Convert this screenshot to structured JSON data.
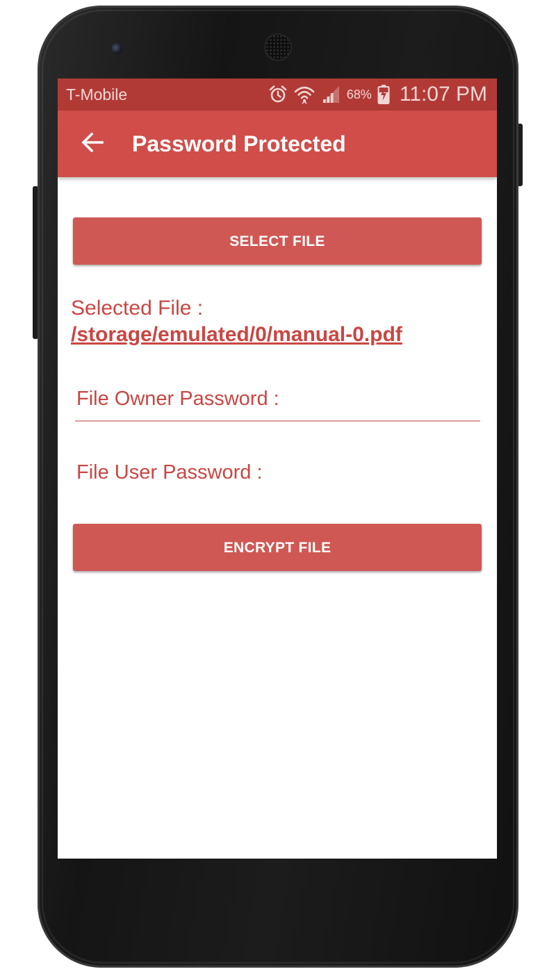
{
  "status_bar": {
    "carrier": "T-Mobile",
    "battery_percent": "68%",
    "time": "11:07 PM",
    "icons": [
      "alarm-icon",
      "wifi-icon",
      "signal-icon",
      "battery-charging-icon"
    ]
  },
  "app_bar": {
    "back_icon": "arrow-back-icon",
    "title": "Password Protected"
  },
  "main": {
    "select_button_label": "SELECT FILE",
    "selected_file_label": "Selected File : ",
    "selected_file_path": "/storage/emulated/0/manual-0.pdf",
    "owner_password_placeholder": "File Owner Password :",
    "user_password_placeholder": "File User Password :",
    "encrypt_button_label": "ENCRYPT FILE"
  },
  "colors": {
    "status_bar": "#b13a36",
    "app_bar": "#d04d49",
    "button": "#d05854",
    "text_accent": "#c94642"
  }
}
